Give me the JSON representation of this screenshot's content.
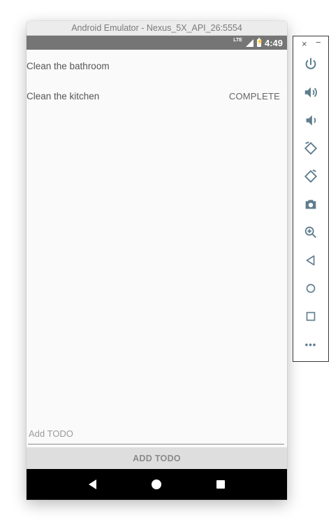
{
  "window": {
    "title": "Android Emulator - Nexus_5X_API_26:5554"
  },
  "statusbar": {
    "network": "LTE",
    "time": "4:49"
  },
  "todos": [
    {
      "text": "Clean the bathroom",
      "action": ""
    },
    {
      "text": "Clean the kitchen",
      "action": "COMPLETE"
    }
  ],
  "add_input": {
    "placeholder": "Add TODO",
    "value": ""
  },
  "add_button": {
    "label": "ADD TODO"
  },
  "toolbar": {
    "close_label": "×",
    "minimize_label": "−",
    "buttons": [
      "power-icon",
      "volume-up-icon",
      "volume-down-icon",
      "rotate-left-icon",
      "rotate-right-icon",
      "camera-icon",
      "zoom-icon",
      "back-icon",
      "home-icon",
      "overview-icon",
      "more-icon"
    ],
    "more_label": "•••"
  },
  "colors": {
    "toolbar_icon": "#5f7d8e",
    "statusbar": "#757575",
    "navbar": "#000000"
  }
}
